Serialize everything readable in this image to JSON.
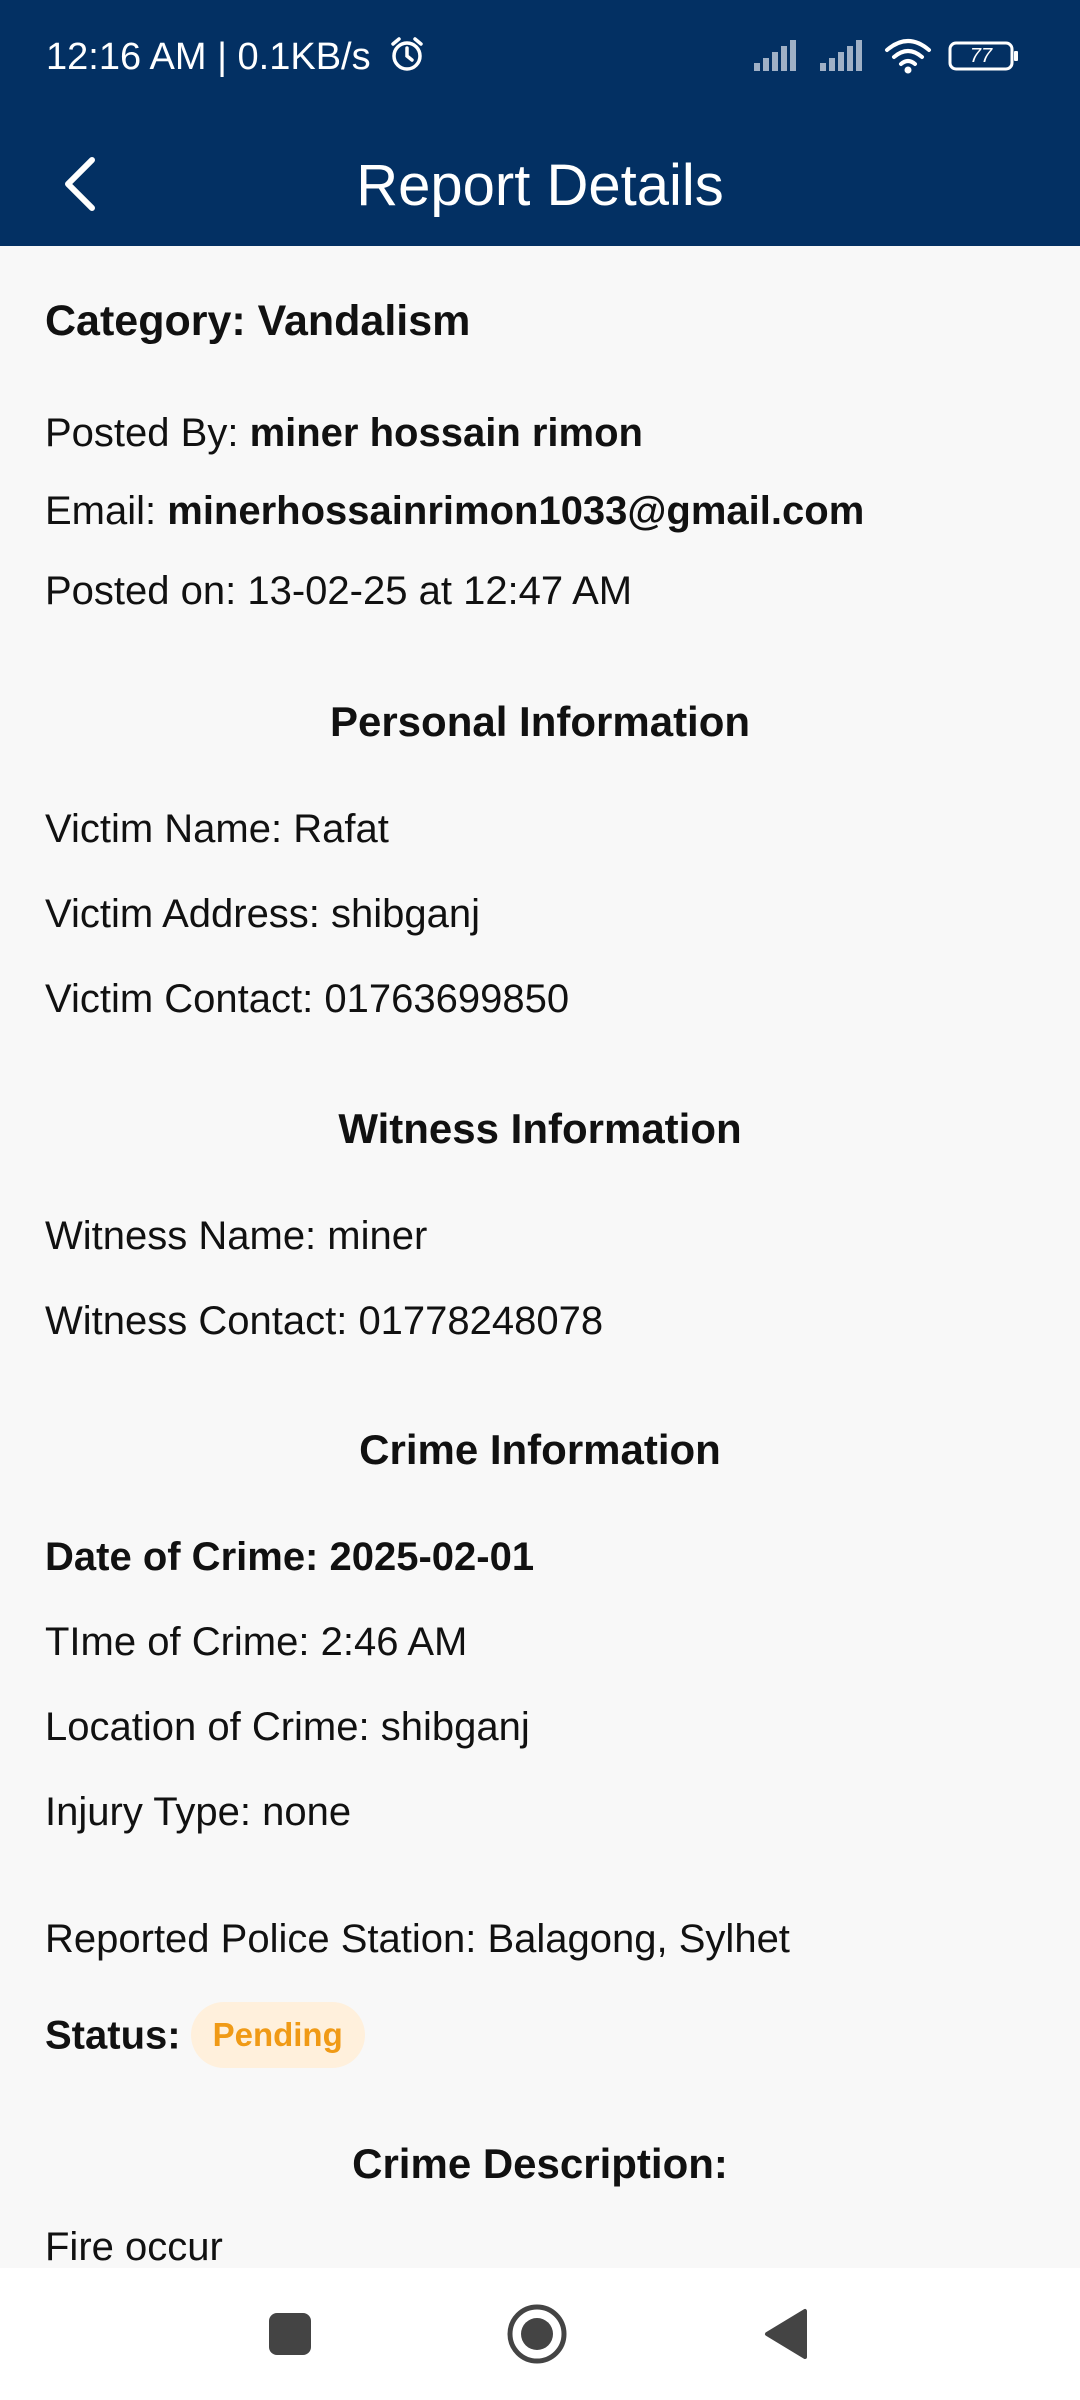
{
  "status_bar": {
    "time": "12:16 AM | 0.1KB/s",
    "battery": "77",
    "icons": [
      "alarm-icon",
      "signal-icon",
      "signal-icon",
      "wifi-icon",
      "battery-icon"
    ]
  },
  "app_bar": {
    "title": "Report Details",
    "back_icon": "chevron-left-icon",
    "background_color": "#033063"
  },
  "report": {
    "category": "Category: Vandalism",
    "posted_by_label": "Posted By: ",
    "posted_by_value": "miner hossain rimon",
    "email_label": "Email: ",
    "email_value": "minerhossainrimon1033@gmail.com",
    "posted_on": "Posted on: 13-02-25 at 12:47 AM"
  },
  "personal": {
    "heading": "Personal Information",
    "victim_name": "Victim Name: Rafat",
    "victim_address": "Victim Address: shibganj",
    "victim_contact": "Victim Contact: 01763699850"
  },
  "witness": {
    "heading": "Witness Information",
    "witness_name": "Witness Name: miner",
    "witness_contact": "Witness Contact: 01778248078"
  },
  "crime": {
    "heading": "Crime Information",
    "date": "Date of Crime: 2025-02-01",
    "time": "TIme of Crime: 2:46 AM",
    "location": "Location of Crime: shibganj",
    "injury": "Injury Type: none",
    "police_station": "Reported Police Station: Balagong, Sylhet",
    "status_label": "Status:",
    "status_value": "Pending",
    "status_color": "#f09a16"
  },
  "description": {
    "heading": "Crime Description:",
    "text": "Fire occur"
  },
  "nav_bar": {
    "icons": [
      "recents-square-icon",
      "home-circle-icon",
      "back-triangle-icon"
    ]
  }
}
